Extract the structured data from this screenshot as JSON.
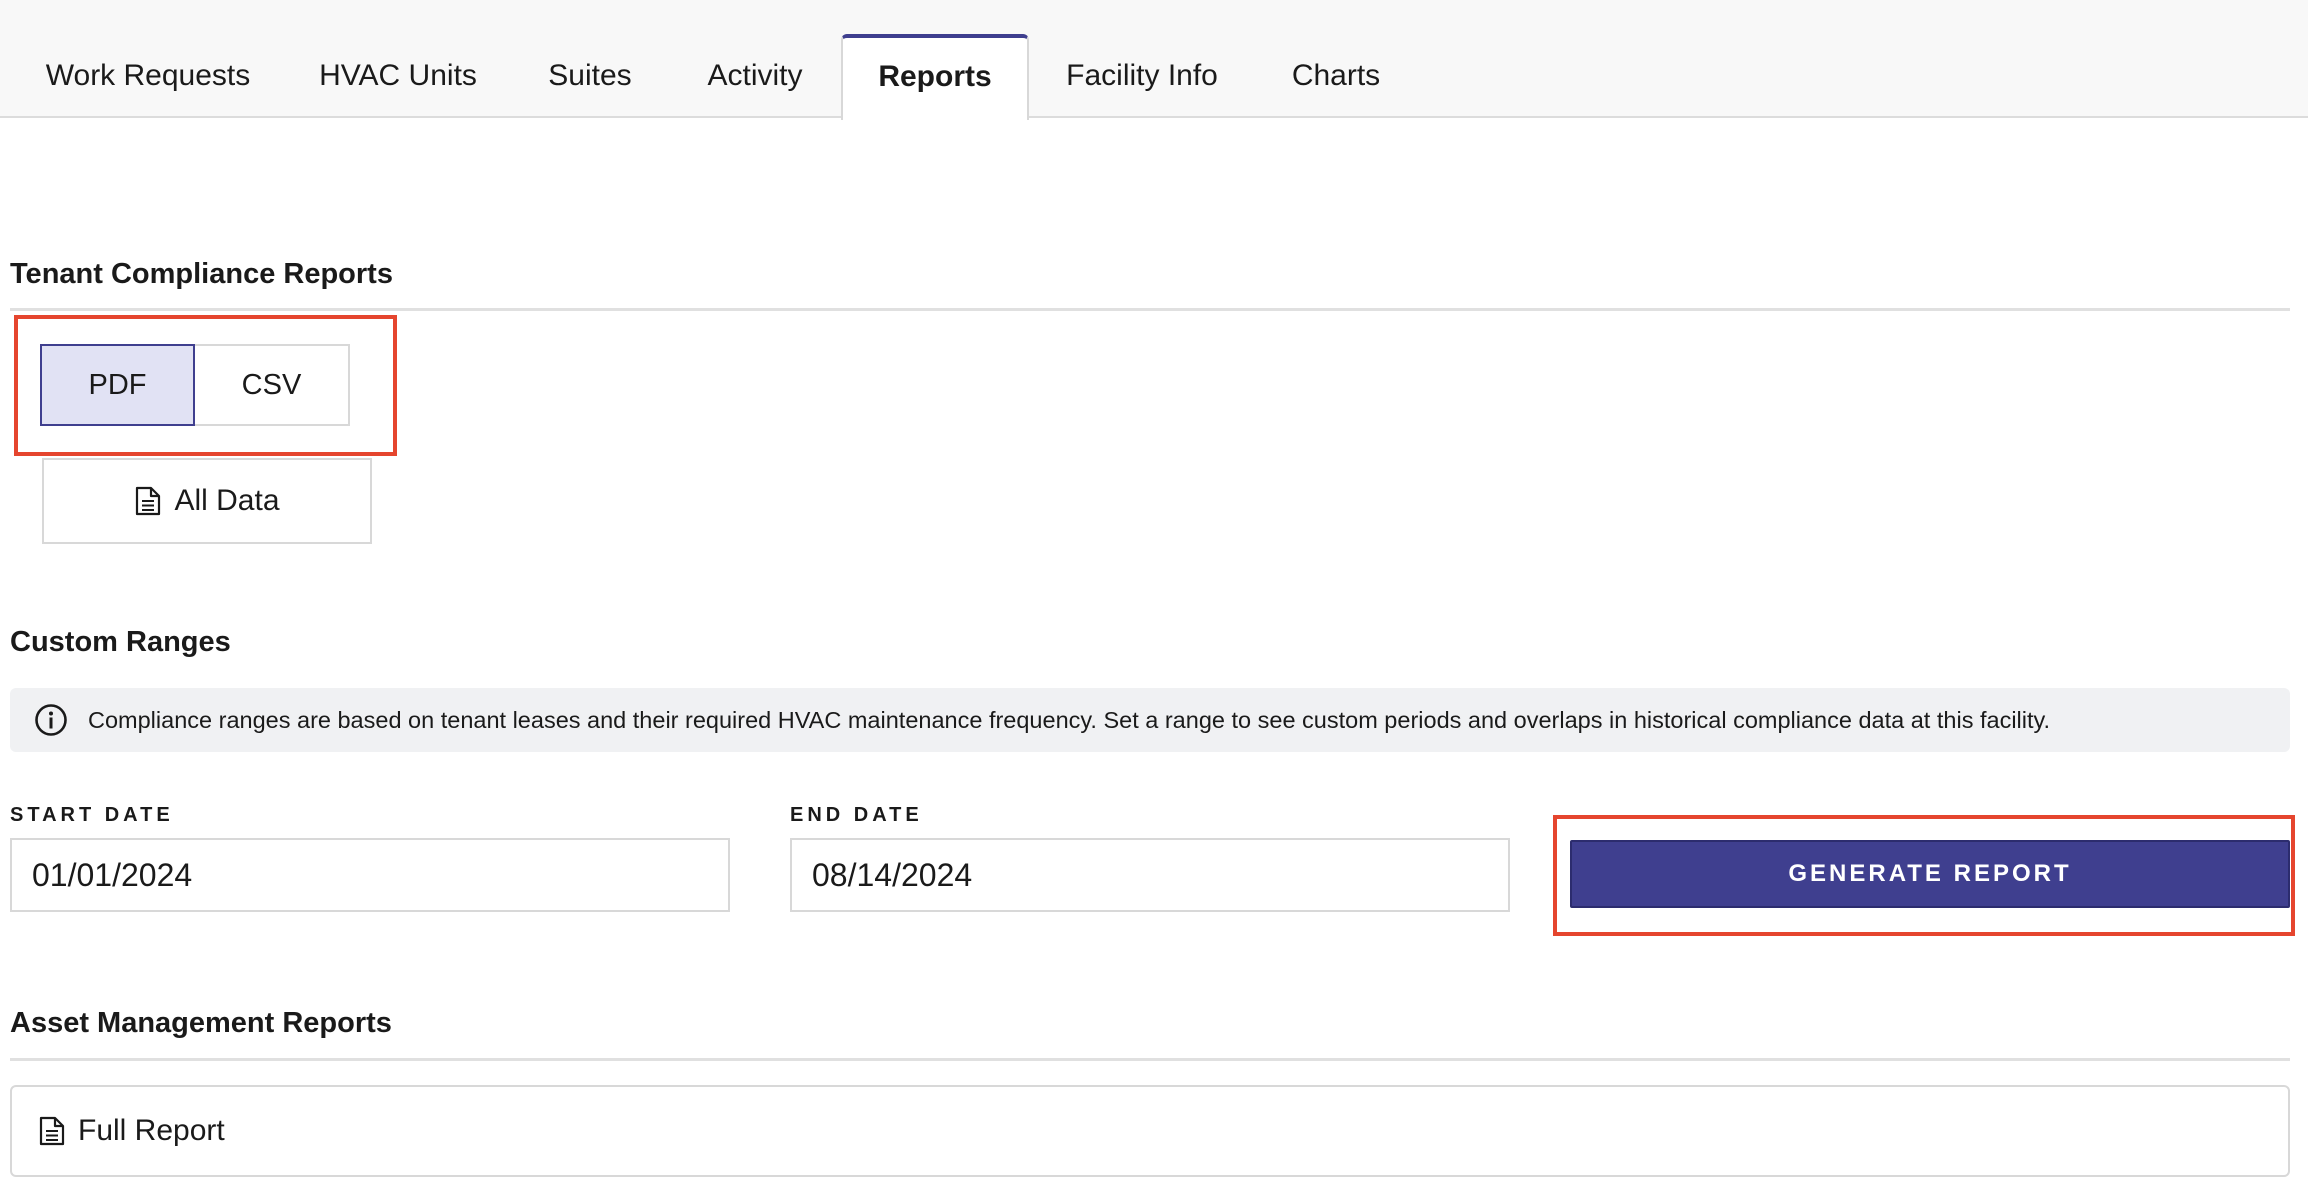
{
  "tabs": [
    {
      "label": "Work Requests",
      "active": false
    },
    {
      "label": "HVAC Units",
      "active": false
    },
    {
      "label": "Suites",
      "active": false
    },
    {
      "label": "Activity",
      "active": false
    },
    {
      "label": "Reports",
      "active": true
    },
    {
      "label": "Facility Info",
      "active": false
    },
    {
      "label": "Charts",
      "active": false
    }
  ],
  "tenant_compliance": {
    "title": "Tenant Compliance Reports",
    "formats": [
      {
        "label": "PDF",
        "selected": true
      },
      {
        "label": "CSV",
        "selected": false
      }
    ],
    "all_data_label": "All Data",
    "all_data_icon": "document-icon"
  },
  "custom_ranges": {
    "title": "Custom Ranges",
    "info_icon": "info-circle-icon",
    "info_text": "Compliance ranges are based on tenant leases and their required HVAC maintenance frequency. Set a range to see custom periods and overlaps in historical compliance data at this facility.",
    "start_label": "START DATE",
    "start_value": "01/01/2024",
    "end_label": "END DATE",
    "end_value": "08/14/2024",
    "generate_label": "GENERATE REPORT"
  },
  "asset_management": {
    "title": "Asset Management Reports",
    "full_report_label": "Full Report",
    "full_report_icon": "document-icon"
  },
  "colors": {
    "accent": "#3f3f8f",
    "selected_bg": "#e1e2f4",
    "annotation": "#e5452e",
    "banner_bg": "#f0f1f3"
  }
}
